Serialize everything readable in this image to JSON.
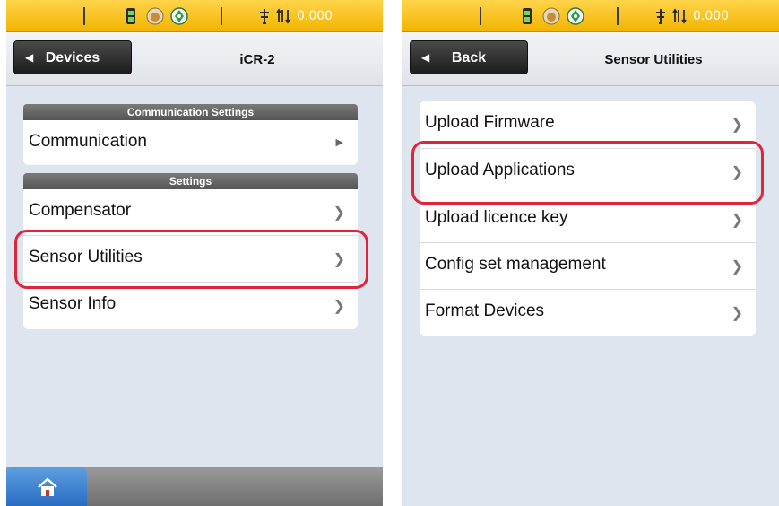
{
  "status_bar": {
    "icons": [
      "battery-radio-icon",
      "hand-stop-icon",
      "target-icon",
      "antenna-icon",
      "signal-updown-icon"
    ],
    "value": "0.000"
  },
  "left_screen": {
    "back_label": "Devices",
    "title": "iCR-2",
    "sections": [
      {
        "header": "Communication Settings",
        "items": [
          {
            "label": "Communication"
          }
        ]
      },
      {
        "header": "Settings",
        "items": [
          {
            "label": "Compensator"
          },
          {
            "label": "Sensor Utilities"
          },
          {
            "label": "Sensor Info"
          }
        ]
      }
    ],
    "highlighted_item": "Sensor Utilities"
  },
  "right_screen": {
    "back_label": "Back",
    "title": "Sensor Utilities",
    "items": [
      {
        "label": "Upload Firmware"
      },
      {
        "label": "Upload Applications"
      },
      {
        "label": "Upload licence key"
      },
      {
        "label": "Config set management"
      },
      {
        "label": "Format Devices"
      }
    ],
    "highlighted_item": "Upload Applications"
  },
  "colors": {
    "status_bar": "#f2b400",
    "highlight": "#e0243c",
    "home_tab": "#2a6cc1"
  }
}
